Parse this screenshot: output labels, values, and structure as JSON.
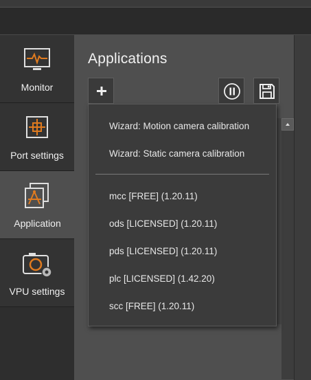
{
  "sidebar": {
    "items": [
      {
        "label": "Monitor",
        "icon": "monitor-icon"
      },
      {
        "label": "Port settings",
        "icon": "crosshair-icon"
      },
      {
        "label": "Application",
        "icon": "application-icon"
      },
      {
        "label": "VPU settings",
        "icon": "camera-gear-icon"
      }
    ],
    "active_index": 2
  },
  "main": {
    "title": "Applications",
    "toolbar": {
      "add_icon": "plus-icon",
      "pause_icon": "pause-icon",
      "save_icon": "save-icon"
    }
  },
  "dropdown": {
    "wizards": [
      "Wizard: Motion camera calibration",
      "Wizard: Static camera calibration"
    ],
    "apps": [
      "mcc [FREE] (1.20.11)",
      "ods [LICENSED] (1.20.11)",
      "pds [LICENSED] (1.20.11)",
      "plc [LICENSED] (1.42.20)",
      "scc [FREE] (1.20.11)"
    ]
  },
  "colors": {
    "accent": "#e07b1f",
    "active_bg": "#4f4f4f",
    "menu_bg": "#3b3b3b"
  }
}
